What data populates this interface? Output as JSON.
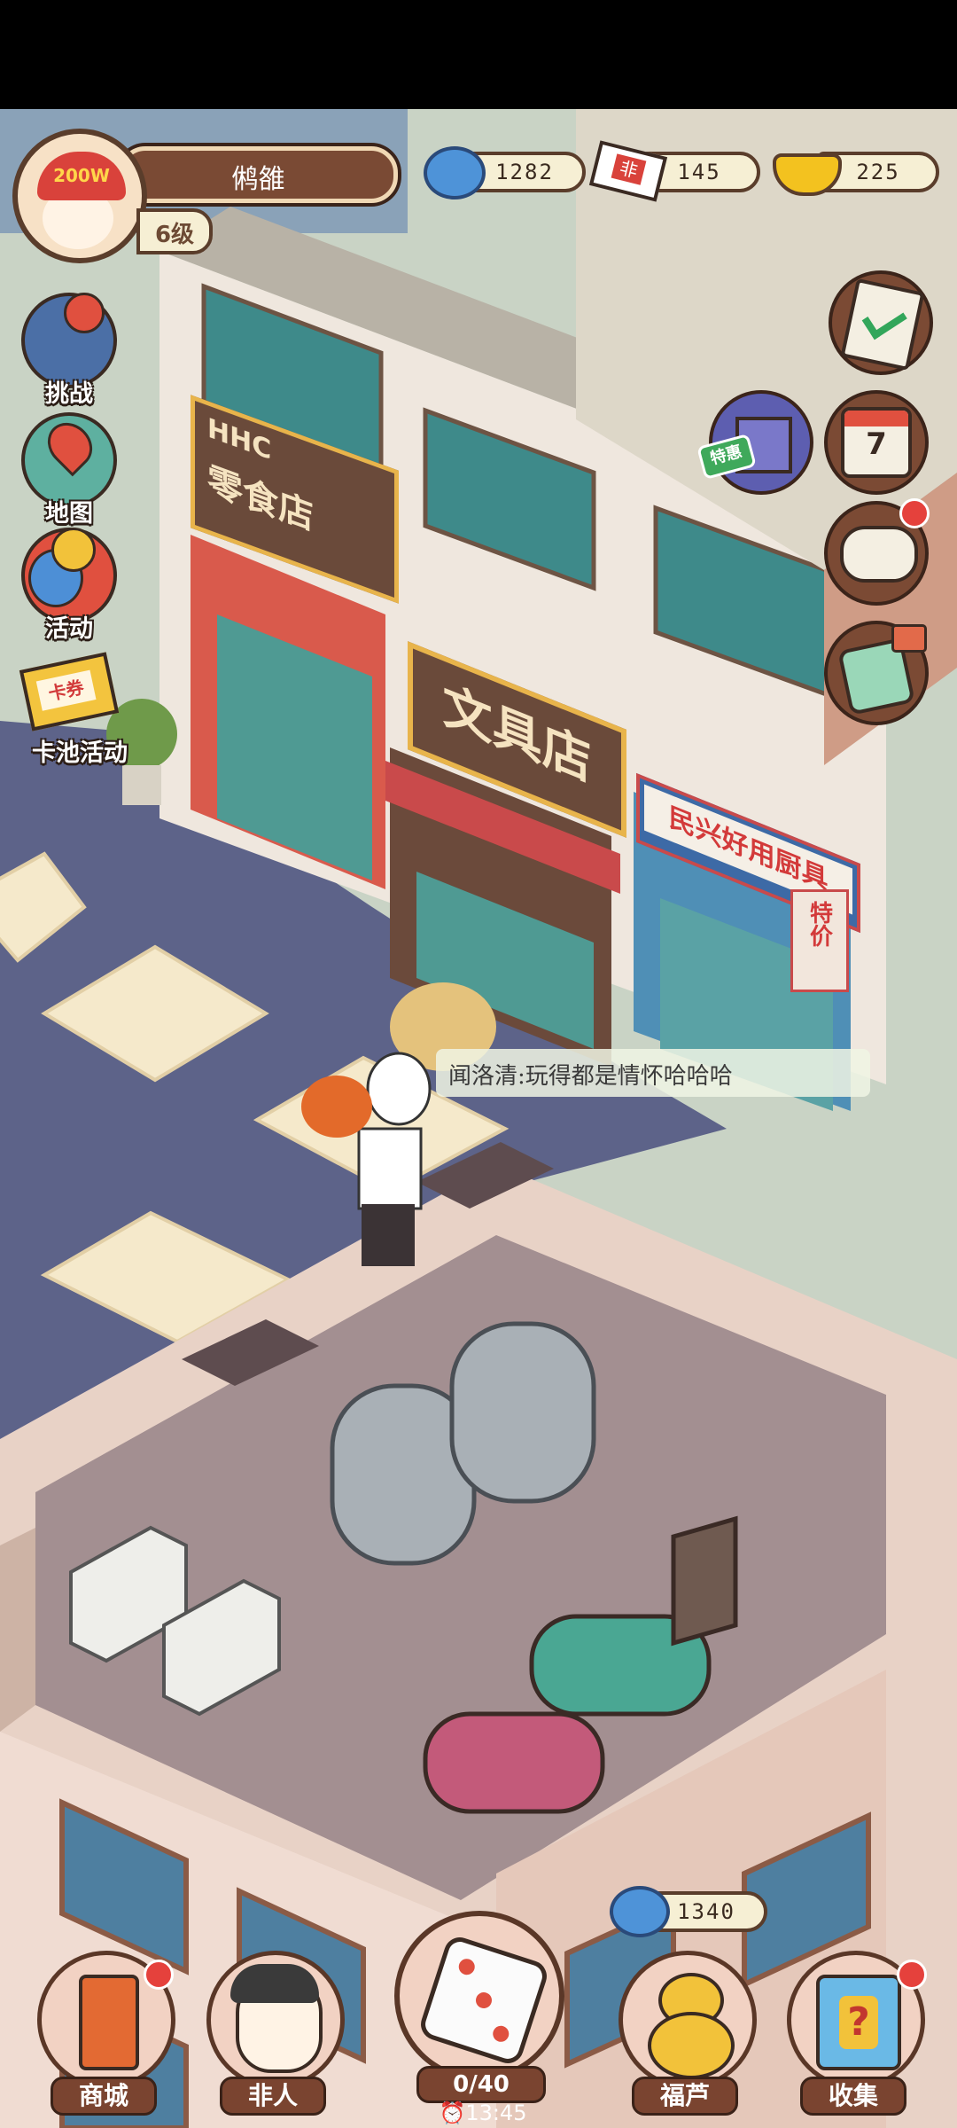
{
  "player": {
    "name": "鸺雒",
    "level": "6级",
    "hat_text": "200W"
  },
  "currencies": [
    {
      "icon": "cloud-coin-icon",
      "value": "1282"
    },
    {
      "icon": "fei-ticket-icon",
      "value": "145",
      "badge": "非"
    },
    {
      "icon": "gold-ingot-icon",
      "value": "225"
    }
  ],
  "left_menu": [
    {
      "label": "挑战",
      "icon": "joystick-icon"
    },
    {
      "label": "地图",
      "icon": "map-pin-icon"
    },
    {
      "label": "活动",
      "icon": "balloons-icon"
    },
    {
      "label": "卡池活动",
      "icon": "card-ticket-icon",
      "badge": "卡券"
    }
  ],
  "right_menu": [
    {
      "icon": "checklist-icon"
    },
    {
      "icon": "gift-box-icon",
      "tag": "特惠"
    },
    {
      "icon": "calendar-icon",
      "day": "7"
    },
    {
      "icon": "chat-bubble-icon"
    },
    {
      "icon": "dice-tv-icon"
    }
  ],
  "shops": {
    "snack": {
      "brand": "HHC",
      "name": "零食店"
    },
    "stationery": {
      "name": "文具店"
    },
    "kitchen": {
      "name": "民兴好用厨具",
      "side": "特价"
    }
  },
  "speech": "闻洛清:玩得都是情怀哈哈哈",
  "dice": {
    "cost": "1340",
    "count": "0/40",
    "timer": "13:45"
  },
  "bottom_nav": [
    {
      "label": "商城",
      "icon": "shop-cabinet-icon"
    },
    {
      "label": "非人",
      "icon": "character-avatar-icon"
    },
    {
      "label": "福芦",
      "icon": "lucky-gourd-icon"
    },
    {
      "label": "收集",
      "icon": "mystery-box-icon"
    }
  ],
  "colors": {
    "frame": "#5a3d2b",
    "pill_bg": "#f6efd4",
    "road": "#5d6389",
    "sidewalk": "#c9d3c5",
    "building": "#f0dcd2",
    "red_dot": "#e5413c"
  }
}
